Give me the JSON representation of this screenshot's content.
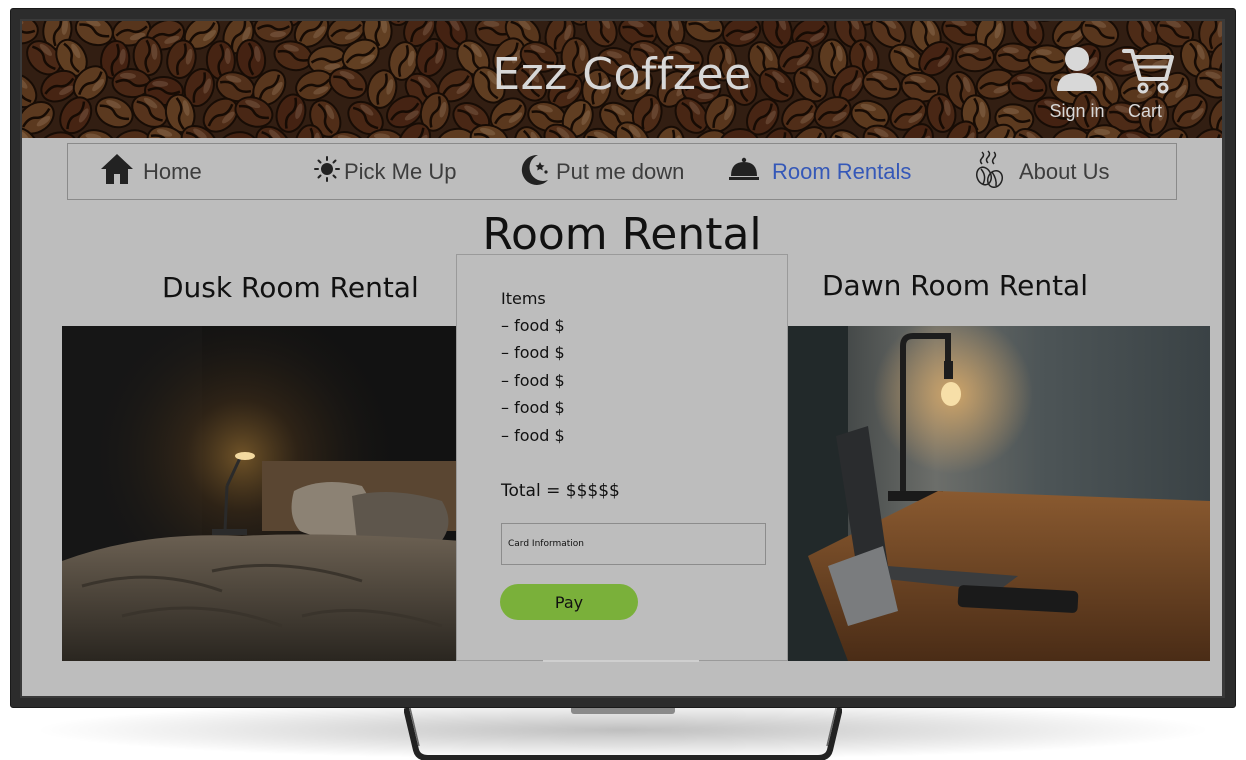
{
  "header": {
    "site_title": "Ezz Coffzee",
    "sign_in_label": "Sign in",
    "cart_label": "Cart",
    "sign_in_icon": "user-icon",
    "cart_icon": "cart-icon"
  },
  "nav": {
    "items": [
      {
        "label": "Home",
        "icon": "home-icon",
        "active": false
      },
      {
        "label": "Pick Me Up",
        "icon": "sun-icon",
        "active": false
      },
      {
        "label": "Put me down",
        "icon": "moon-stars-icon",
        "active": false
      },
      {
        "label": "Room Rentals",
        "icon": "service-bell-icon",
        "active": true
      },
      {
        "label": "About Us",
        "icon": "coffee-beans-icon",
        "active": false
      }
    ]
  },
  "page": {
    "title": "Room Rental",
    "dusk_heading": "Dusk Room Rental",
    "dawn_heading": "Dawn Room Rental"
  },
  "checkout": {
    "items_title": "Items",
    "items": [
      "– food $",
      "– food $",
      "– food $",
      "– food $",
      "– food $"
    ],
    "total": "Total = $$$$$",
    "card_placeholder": "Card Information",
    "pay_label": "Pay"
  },
  "colors": {
    "screen_bg": "#bdbdbd",
    "active_nav": "#3558b8",
    "pay_button": "#7ab03a",
    "title_text": "#d8d8d8"
  }
}
